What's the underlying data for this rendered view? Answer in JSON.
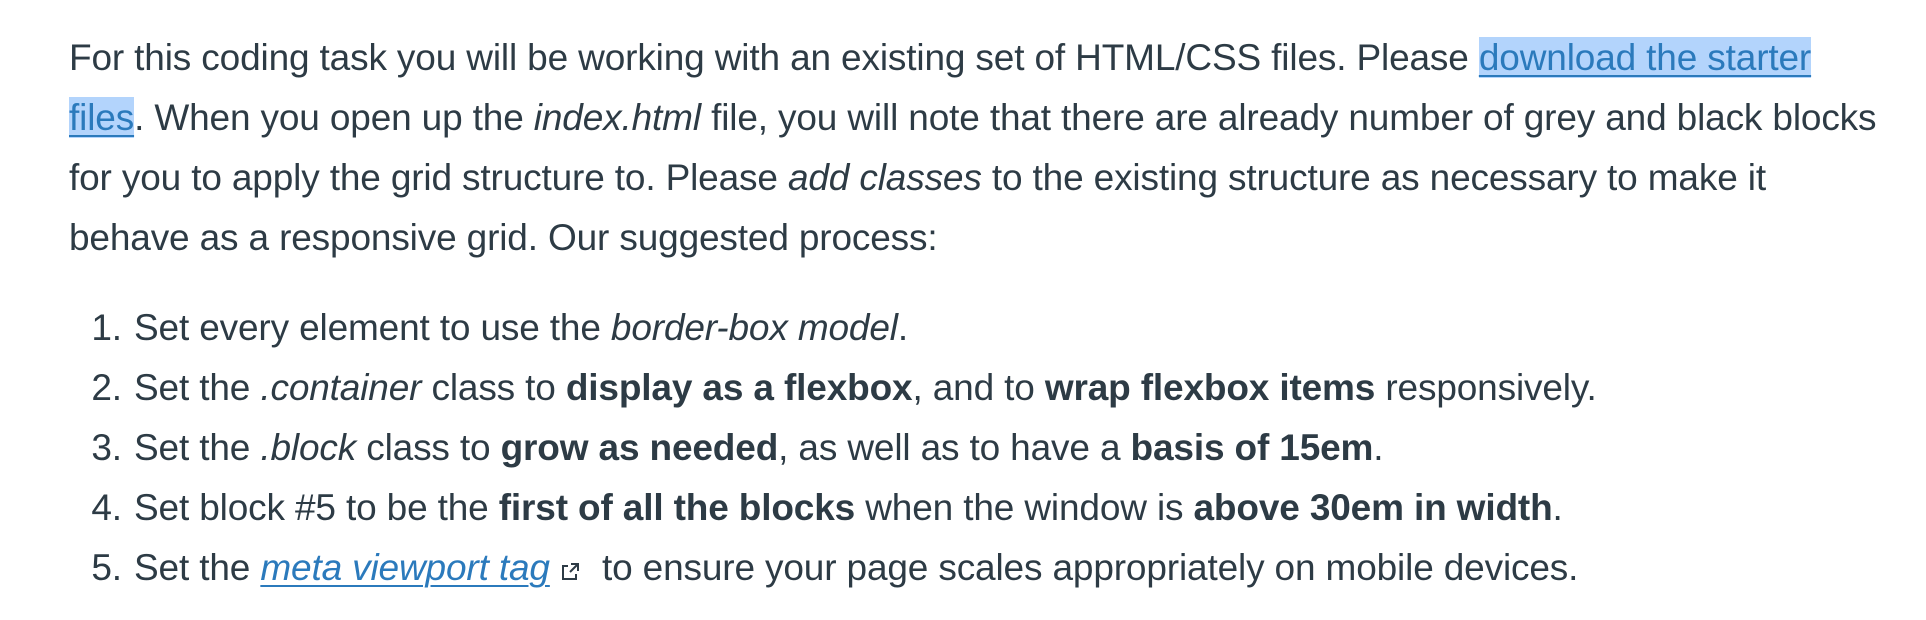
{
  "intro": {
    "t1": "For this coding task you will be working with an existing set of HTML/CSS files. Please ",
    "link_download": "download the starter files",
    "t2": ". When you open up the ",
    "em_index": "index.html",
    "t3": " file, you will note that there are already number of grey and black blocks for you to apply the grid structure to. Please ",
    "em_add": "add classes",
    "t4": " to the existing structure as necessary to make it behave as a responsive grid. Our suggested process:"
  },
  "steps": [
    {
      "a": "Set every element to use the ",
      "em": "border-box model",
      "b": "."
    },
    {
      "a": "Set the ",
      "em": ".container",
      "b": " class to ",
      "strong1": "display as a flexbox",
      "c": ", and to ",
      "strong2": "wrap flexbox items",
      "d": " responsively."
    },
    {
      "a": "Set the ",
      "em": ".block",
      "b": " class to ",
      "strong1": "grow as needed",
      "c": ", as well as to have a ",
      "strong2": "basis of 15em",
      "d": "."
    },
    {
      "a": "Set block #5 to be the ",
      "strong1": "first of all the blocks",
      "b": " when the window is ",
      "strong2": "above 30em in width",
      "c": "."
    },
    {
      "a": "Set the ",
      "link": "meta viewport tag",
      "icon": "external-link-icon",
      "b": " to ensure your page scales appropriately on mobile devices."
    }
  ],
  "colors": {
    "text": "#2d3b45",
    "link": "#2b7abc",
    "selection": "#b3d4fc"
  }
}
